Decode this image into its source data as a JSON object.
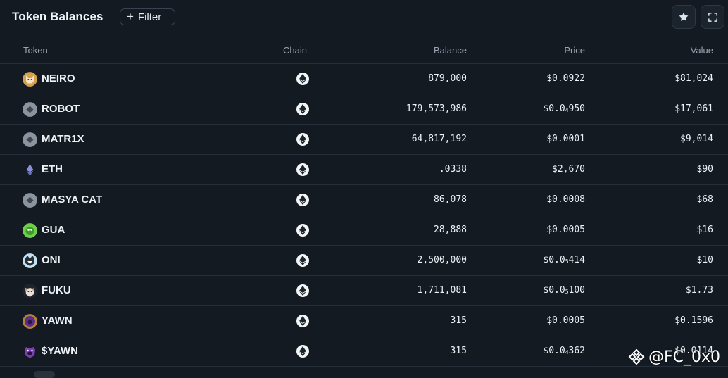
{
  "header": {
    "title": "Token Balances",
    "filter_label": "Filter"
  },
  "columns": {
    "token": "Token",
    "chain": "Chain",
    "balance": "Balance",
    "price": "Price",
    "value": "Value"
  },
  "rows": [
    {
      "name": "NEIRO",
      "icon": "neiro-dog-icon",
      "chain": "ethereum",
      "balance": "879,000",
      "price_main": "$0.0922",
      "price_sub": "",
      "price_rest": "",
      "value": "$81,024"
    },
    {
      "name": "ROBOT",
      "icon": "generic-token-icon",
      "chain": "ethereum",
      "balance": "179,573,986",
      "price_main": "$0.0",
      "price_sub": "4",
      "price_rest": "950",
      "value": "$17,061"
    },
    {
      "name": "MATR1X",
      "icon": "generic-token-icon",
      "chain": "ethereum",
      "balance": "64,817,192",
      "price_main": "$0.0001",
      "price_sub": "",
      "price_rest": "",
      "value": "$9,014"
    },
    {
      "name": "ETH",
      "icon": "ethereum-icon",
      "chain": "ethereum",
      "balance": ".0338",
      "price_main": "$2,670",
      "price_sub": "",
      "price_rest": "",
      "value": "$90"
    },
    {
      "name": "MASYA CAT",
      "icon": "generic-token-icon",
      "chain": "ethereum",
      "balance": "86,078",
      "price_main": "$0.0008",
      "price_sub": "",
      "price_rest": "",
      "value": "$68"
    },
    {
      "name": "GUA",
      "icon": "gua-green-icon",
      "chain": "ethereum",
      "balance": "28,888",
      "price_main": "$0.0005",
      "price_sub": "",
      "price_rest": "",
      "value": "$16"
    },
    {
      "name": "ONI",
      "icon": "oni-cat-icon",
      "chain": "ethereum",
      "balance": "2,500,000",
      "price_main": "$0.0",
      "price_sub": "5",
      "price_rest": "414",
      "value": "$10"
    },
    {
      "name": "FUKU",
      "icon": "fuku-dog-icon",
      "chain": "ethereum",
      "balance": "1,711,081",
      "price_main": "$0.0",
      "price_sub": "5",
      "price_rest": "100",
      "value": "$1.73"
    },
    {
      "name": "YAWN",
      "icon": "yawn-purple-icon",
      "chain": "ethereum",
      "balance": "315",
      "price_main": "$0.0005",
      "price_sub": "",
      "price_rest": "",
      "value": "$0.1596"
    },
    {
      "name": "$YAWN",
      "icon": "yawn-purple-face-icon",
      "chain": "ethereum",
      "balance": "315",
      "price_main": "$0.0",
      "price_sub": "4",
      "price_rest": "362",
      "value": "$0.0114"
    }
  ],
  "watermark": {
    "text": "@FC_0x0"
  },
  "colors": {
    "background": "#131a22",
    "text": "#eef2f6",
    "muted": "#9aa4b0",
    "divider": "#262f39"
  }
}
